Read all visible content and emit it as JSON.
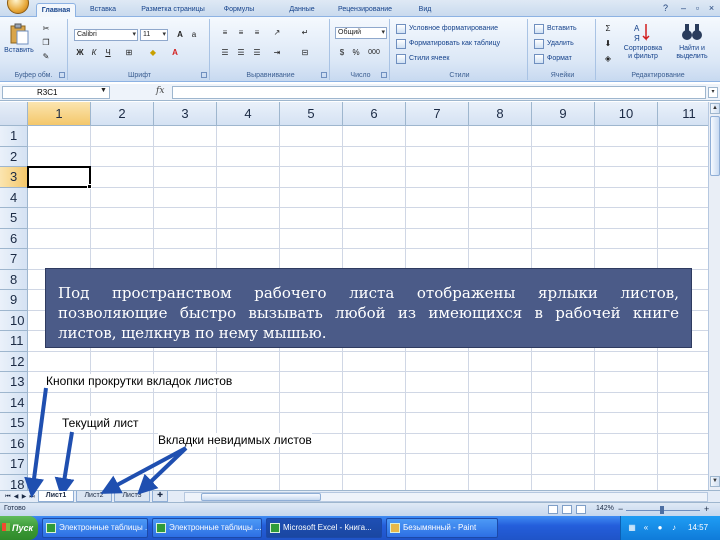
{
  "ribbon": {
    "tabs": [
      "Главная",
      "Вставка",
      "Разметка страницы",
      "Формулы",
      "Данные",
      "Рецензирование",
      "Вид"
    ],
    "groups": {
      "clipboard": {
        "paste_label": "Вставить",
        "label": "Буфер обм."
      },
      "font": {
        "font_name": "Calibri",
        "font_size": "11",
        "label": "Шрифт"
      },
      "alignment": {
        "label": "Выравнивание"
      },
      "number": {
        "format": "Общий",
        "label": "Число"
      },
      "styles": {
        "conditional": "Условное форматирование",
        "as_table": "Форматировать как таблицу",
        "cell_styles": "Стили ячеек",
        "label": "Стили"
      },
      "cells": {
        "insert": "Вставить",
        "delete": "Удалить",
        "format": "Формат",
        "label": "Ячейки"
      },
      "editing": {
        "sort": "Сортировка",
        "sort2": "и фильтр",
        "find": "Найти и",
        "find2": "выделить",
        "label": "Редактирование"
      }
    }
  },
  "formula_bar": {
    "name_box": "R3C1",
    "fx": "fx",
    "formula": ""
  },
  "grid": {
    "columns": [
      "1",
      "2",
      "3",
      "4",
      "5",
      "6",
      "7",
      "8",
      "9",
      "10",
      "11"
    ],
    "rows": [
      "1",
      "2",
      "3",
      "4",
      "5",
      "6",
      "7",
      "8",
      "9",
      "10",
      "11",
      "12",
      "13",
      "14",
      "15",
      "16",
      "17",
      "18"
    ],
    "active_row": 3,
    "active_col": 1
  },
  "sheets": {
    "tabs": [
      "Лист1",
      "Лист2",
      "Лист3"
    ],
    "active": 0
  },
  "status": {
    "text": "Готово",
    "zoom": "142%"
  },
  "taskbar": {
    "start": "Пуск",
    "tasks": [
      "Электронные таблицы ...",
      "Электронные таблицы ...",
      "Microsoft Excel - Книга...",
      "Безымянный - Paint"
    ],
    "active": 2,
    "clock": "14:57"
  },
  "annotations": {
    "callout": "Под пространством рабочего листа отображены ярлыки листов, позволяющие быстро вызывать любой из имеющихся в рабочей книге листов, щелкнув по нему мышью.",
    "scroll_buttons": "Кнопки прокрутки вкладок листов",
    "current_sheet": "Текущий лист",
    "hidden_tabs": "Вкладки невидимых листов"
  },
  "colors": {
    "ribbon_text": "#15428b",
    "callout_bg": "#4b5b88",
    "grid_line": "#d0d7e5",
    "taskbar": "#245edb"
  }
}
